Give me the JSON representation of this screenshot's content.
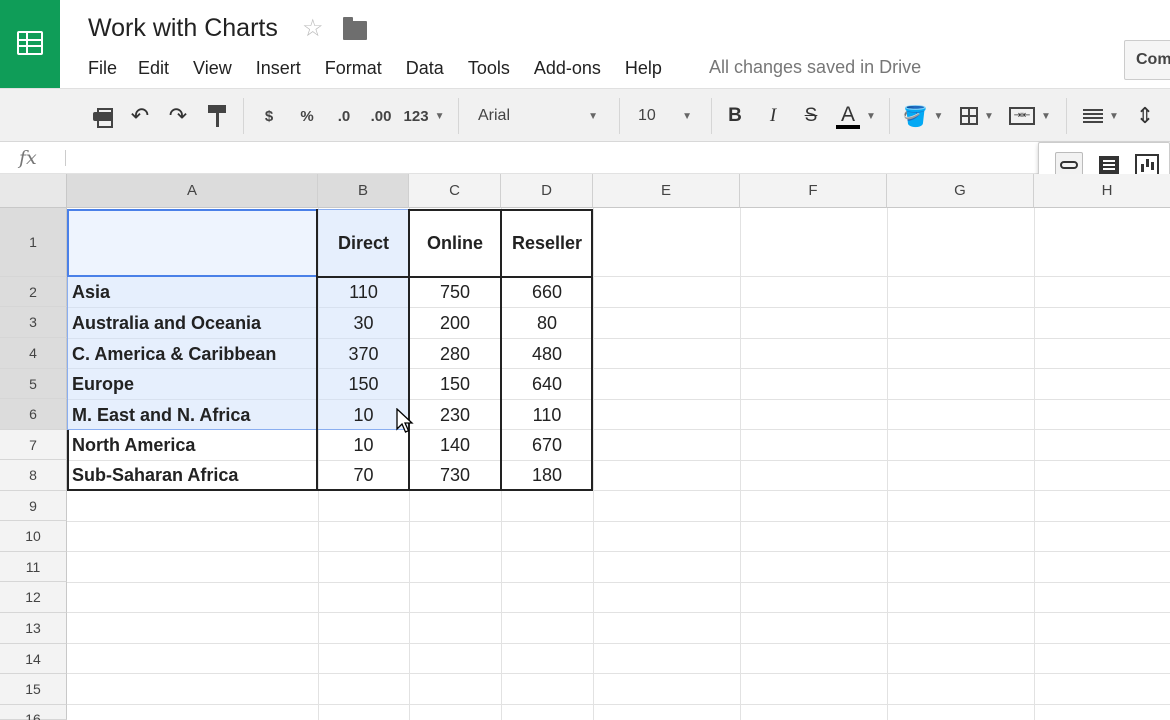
{
  "app": {
    "doc_title": "Work with Charts",
    "save_status": "All changes saved in Drive",
    "comments_label": "Comments",
    "brand_color": "#0f9d58"
  },
  "menus": [
    "File",
    "Edit",
    "View",
    "Insert",
    "Format",
    "Data",
    "Tools",
    "Add-ons",
    "Help"
  ],
  "toolbar": {
    "currency": "$",
    "percent": "%",
    "decrease_decimals": ".0",
    "increase_decimals": ".00",
    "more_formats": "123",
    "font": "Arial",
    "font_size": "10",
    "bold": "B",
    "italic": "I",
    "strikethrough": "S",
    "text_color": "A"
  },
  "formula_bar": {
    "fx": "fx",
    "value": ""
  },
  "columns": [
    "A",
    "B",
    "C",
    "D",
    "E",
    "F",
    "G",
    "H"
  ],
  "rows": [
    "1",
    "2",
    "3",
    "4",
    "5",
    "6",
    "7",
    "8",
    "9",
    "10",
    "11",
    "12",
    "13",
    "14",
    "15",
    "16"
  ],
  "table": {
    "headers": [
      "",
      "Direct",
      "Online",
      "Reseller"
    ],
    "rows": [
      [
        "Asia",
        "110",
        "750",
        "660"
      ],
      [
        "Australia and Oceania",
        "30",
        "200",
        "80"
      ],
      [
        "C. America & Caribbean",
        "370",
        "280",
        "480"
      ],
      [
        "Europe",
        "150",
        "150",
        "640"
      ],
      [
        "M. East and N. Africa",
        "10",
        "230",
        "110"
      ],
      [
        "North America",
        "10",
        "140",
        "670"
      ],
      [
        "Sub-Saharan Africa",
        "70",
        "730",
        "180"
      ]
    ]
  },
  "selection": {
    "range": "A1:B6",
    "active_cell": "A1",
    "highlight_color": "#cddffc",
    "border_color": "#4a80e8"
  }
}
